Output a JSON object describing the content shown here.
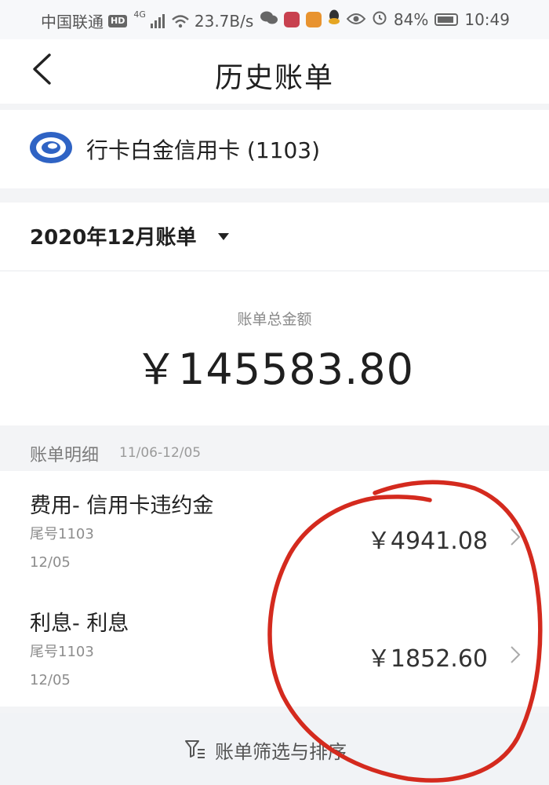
{
  "status_bar": {
    "carrier": "中国联通",
    "hd": "HD",
    "net": "4G",
    "speed": "23.7B/s",
    "battery": "84%",
    "time": "10:49"
  },
  "header": {
    "title": "历史账单",
    "back_icon": "chevron-left-icon"
  },
  "card": {
    "name": "行卡白金信用卡 (1103)",
    "logo_icon": "bank-logo-icon"
  },
  "statement": {
    "month_label": "2020年12月账单",
    "caret_icon": "caret-down-icon"
  },
  "total": {
    "label": "账单总金额",
    "amount": "￥145583.80"
  },
  "details": {
    "title": "账单明细",
    "range": "11/06-12/05"
  },
  "transactions": [
    {
      "description": "费用- 信用卡违约金",
      "card_tail": "尾号1103",
      "date": "12/05",
      "amount": "￥4941.08"
    },
    {
      "description": "利息- 利息",
      "card_tail": "尾号1103",
      "date": "12/05",
      "amount": "￥1852.60"
    }
  ],
  "filter": {
    "label": "账单筛选与排序",
    "icon": "filter-sort-icon"
  },
  "colors": {
    "annotation": "#d42a1e",
    "logo_blue": "#2f63c4"
  }
}
